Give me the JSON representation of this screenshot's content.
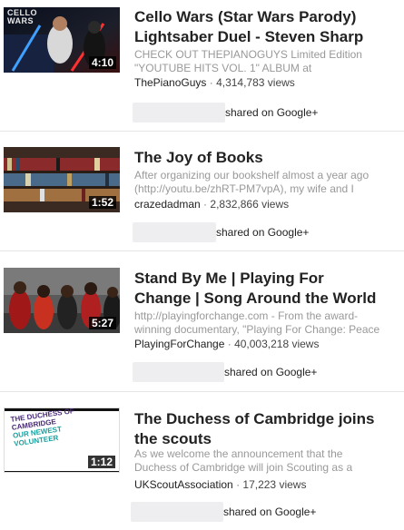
{
  "colors": {
    "title": "#222222",
    "description": "#999999",
    "meta": "#444444",
    "divider": "#e5e5e5",
    "duration_bg": "#000000"
  },
  "videos": [
    {
      "thumbnail_text": [
        "CELLO",
        "WARS"
      ],
      "duration": "4:10",
      "title_line1": "Cello Wars (Star Wars Parody)",
      "title_line2": "Lightsaber Duel - Steven Sharp",
      "desc_line1": "CHECK OUT THEPIANOGUYS Limited Edition",
      "desc_line2": "\"YOUTUBE HITS VOL. 1\" ALBUM at",
      "channel": "ThePianoGuys",
      "views": "4,314,783 views",
      "share_text": "shared on Google+"
    },
    {
      "duration": "1:52",
      "title_line1": "The Joy of Books",
      "desc_line1": "After organizing our bookshelf almost a year ago",
      "desc_line2": "(http://youtu.be/zhRT-PM7vpA), my wife and I",
      "channel": "crazedadman",
      "views": "2,832,866 views",
      "share_text": "shared on Google+"
    },
    {
      "duration": "5:27",
      "title_line1": "Stand By Me | Playing For",
      "title_line2": "Change | Song Around the World",
      "desc_line1": "http://playingforchange.com - From the award-",
      "desc_line2": "winning documentary, \"Playing For Change: Peace",
      "channel": "PlayingForChange",
      "views": "40,003,218 views",
      "share_text": "shared on Google+"
    },
    {
      "thumbnail_text": [
        "THE DUCHESS OF",
        "CAMBRIDGE",
        "OUR NEWEST",
        "VOLUNTEER"
      ],
      "duration": "1:12",
      "title_line1": "The Duchess of Cambridge joins",
      "title_line2": "the scouts",
      "desc_line1": "As we welcome the announcement that the",
      "desc_line2": "Duchess of Cambridge will join Scouting as a",
      "channel": "UKScoutAssociation",
      "views": "17,223 views",
      "share_text": "shared on Google+"
    }
  ]
}
